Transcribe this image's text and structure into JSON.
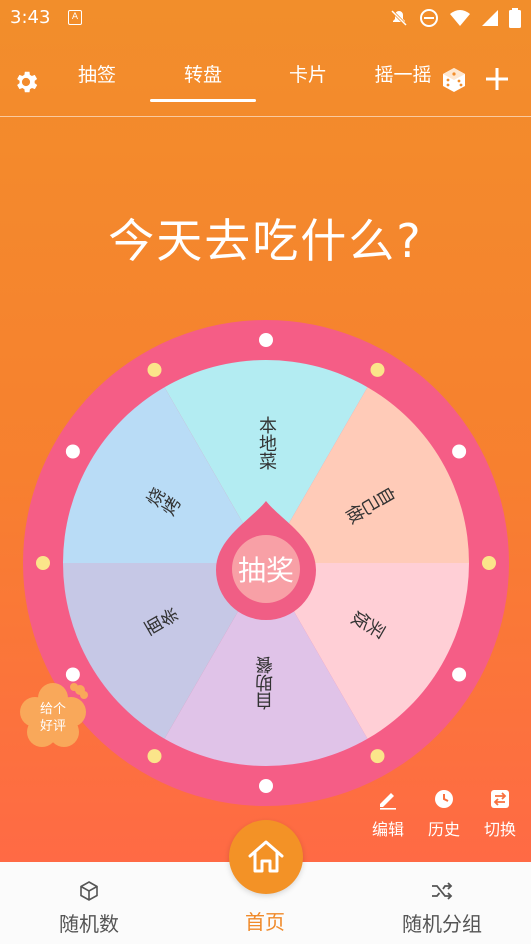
{
  "status_bar": {
    "time": "3:43",
    "app_icon": "A"
  },
  "top_nav": {
    "tabs": [
      "抽签",
      "转盘",
      "卡片",
      "摇一摇"
    ],
    "active_tab": "转盘"
  },
  "title": "今天去吃什么?",
  "wheel": {
    "center_label": "抽奖",
    "segments": [
      {
        "label": "本地菜",
        "color": "#b3ecf2"
      },
      {
        "label": "自己做",
        "color": "#ffcbb8"
      },
      {
        "label": "买饭",
        "color": "#ffcfd6"
      },
      {
        "label": "自助餐",
        "color": "#e0c3e8"
      },
      {
        "label": "面条",
        "color": "#c6c8e6"
      },
      {
        "label": "烧烤",
        "color": "#b9dcf6"
      }
    ],
    "rim_color": "#f55d86"
  },
  "review_badge": {
    "line1": "给个",
    "line2": "好评"
  },
  "tools": {
    "edit": "编辑",
    "history": "历史",
    "switch": "切换"
  },
  "bottom_nav": {
    "left": "随机数",
    "center": "首页",
    "right": "随机分组"
  },
  "colors": {
    "accent": "#f39226",
    "bg_top": "#f28e2b",
    "bg_bottom": "#ff6a45"
  }
}
